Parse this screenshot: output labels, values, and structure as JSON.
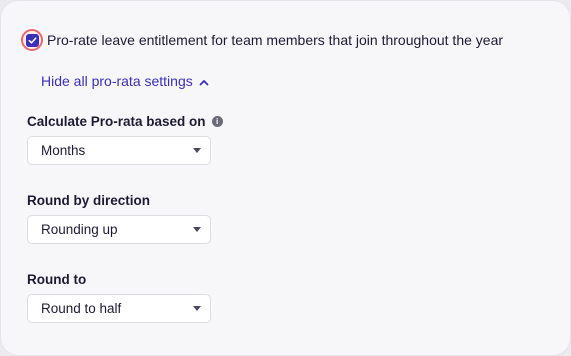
{
  "prorate_checkbox": {
    "label": "Pro-rate leave entitlement for team members that join throughout the year",
    "checked": true
  },
  "toggle_link": {
    "label": "Hide all pro-rata settings"
  },
  "calculate_based_on": {
    "label": "Calculate Pro-rata based on",
    "value": "Months"
  },
  "round_direction": {
    "label": "Round by direction",
    "value": "Rounding up"
  },
  "round_to": {
    "label": "Round to",
    "value": "Round to half"
  },
  "colors": {
    "accent": "#3a2fb8",
    "focus_ring": "#e86a6a"
  }
}
